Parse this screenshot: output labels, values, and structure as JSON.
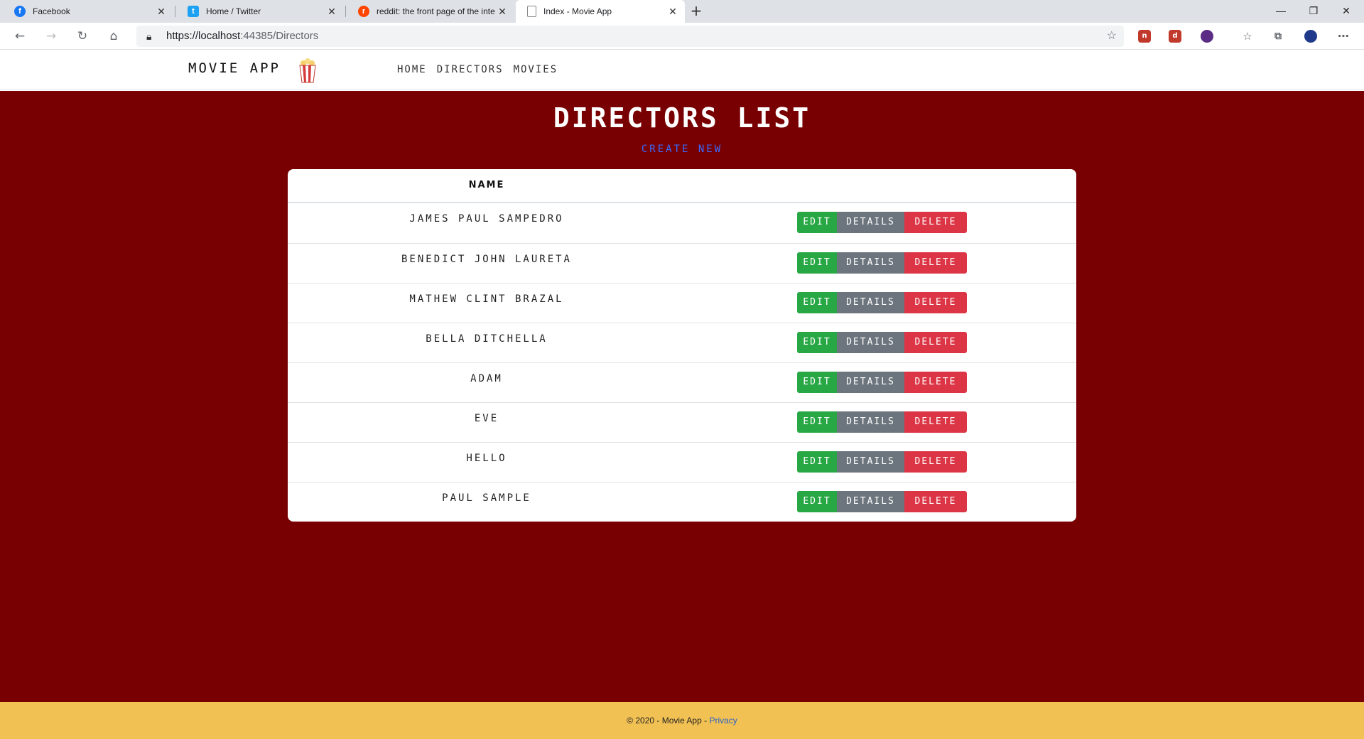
{
  "browser": {
    "tabs": [
      {
        "title": "Facebook",
        "icon": "facebook-icon",
        "color": "#1877f2"
      },
      {
        "title": "Home / Twitter",
        "icon": "twitter-icon",
        "color": "#1da1f2"
      },
      {
        "title": "reddit: the front page of the inte",
        "icon": "reddit-icon",
        "color": "#ff4500"
      },
      {
        "title": "Index - Movie App",
        "icon": "page-icon",
        "color": "#5f6368"
      }
    ],
    "url_host": "https://localhost",
    "url_rest": ":44385/Directors"
  },
  "site": {
    "brand": "MOVIE APP",
    "nav": [
      "HOME",
      "DIRECTORS",
      "MOVIES"
    ]
  },
  "page": {
    "title": "DIRECTORS LIST",
    "create_new": "CREATE NEW",
    "column_name": "NAME",
    "actions": {
      "edit": "EDIT",
      "details": "DETAILS",
      "delete": "DELETE"
    },
    "directors": [
      "JAMES PAUL SAMPEDRO",
      "BENEDICT JOHN LAURETA",
      "MATHEW CLINT BRAZAL",
      "BELLA DITCHELLA",
      "ADAM",
      "EVE",
      "HELLO",
      "PAUL SAMPLE"
    ],
    "background_color": "#780002"
  },
  "footer": {
    "text": "© 2020 - Movie App - ",
    "privacy": "Privacy",
    "background_color": "#f2c154"
  }
}
